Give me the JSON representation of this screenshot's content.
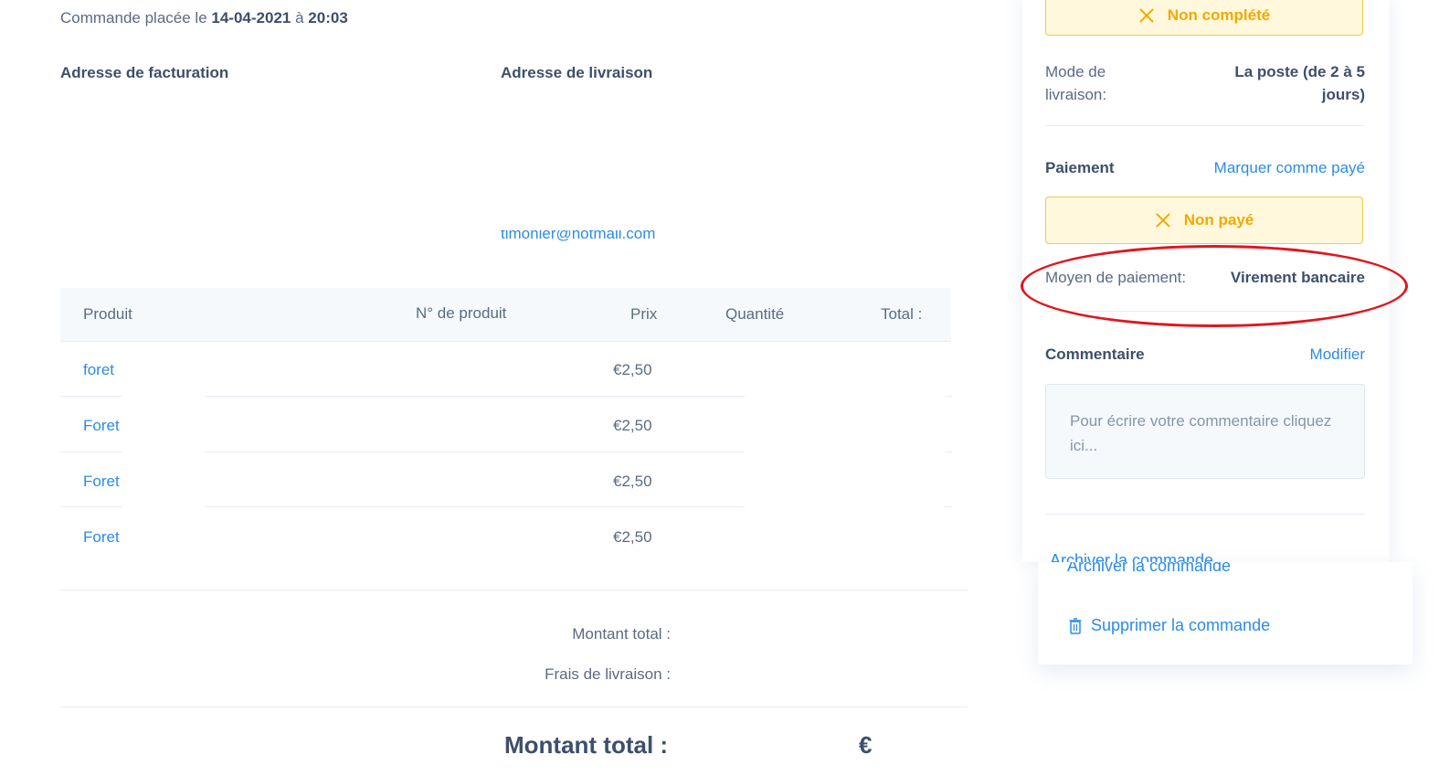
{
  "order": {
    "placed_prefix": "Commande placée le",
    "date": "14-04-2021",
    "at": "à",
    "time": "20:03"
  },
  "addresses": {
    "billing_title": "Adresse de facturation",
    "shipping_title": "Adresse de livraison",
    "email_partial": "timonier@hotmail.com"
  },
  "table": {
    "headers": [
      "Produit",
      "N° de produit",
      "Prix",
      "Quantité",
      "Total :"
    ],
    "rows": [
      {
        "name": "foret",
        "price": "€2,50"
      },
      {
        "name": "Foret",
        "price": "€2,50"
      },
      {
        "name": "Foret",
        "price": "€2,50"
      },
      {
        "name": "Foret",
        "price": "€2,50"
      }
    ]
  },
  "summary": {
    "subtotal_label": "Montant total :",
    "shipping_label": "Frais de livraison :",
    "total_label": "Montant total :",
    "total_currency": "€"
  },
  "panel": {
    "status_badge": "Non complété",
    "delivery_label": "Mode de livraison:",
    "delivery_value": "La poste (de 2 à 5 jours)",
    "payment_title": "Paiement",
    "mark_paid": "Marquer comme payé",
    "payment_badge": "Non payé",
    "payment_method_label": "Moyen de paiement:",
    "payment_method_value": "Virement bancaire",
    "comment_title": "Commentaire",
    "comment_edit": "Modifier",
    "comment_placeholder": "Pour écrire votre commentaire cliquez ici...",
    "archive": "Archiver la commande",
    "delete": "Supprimer la commande"
  },
  "colors": {
    "accent": "#2b8ce6",
    "warning": "#f2a900",
    "annotation": "#e0161e"
  }
}
